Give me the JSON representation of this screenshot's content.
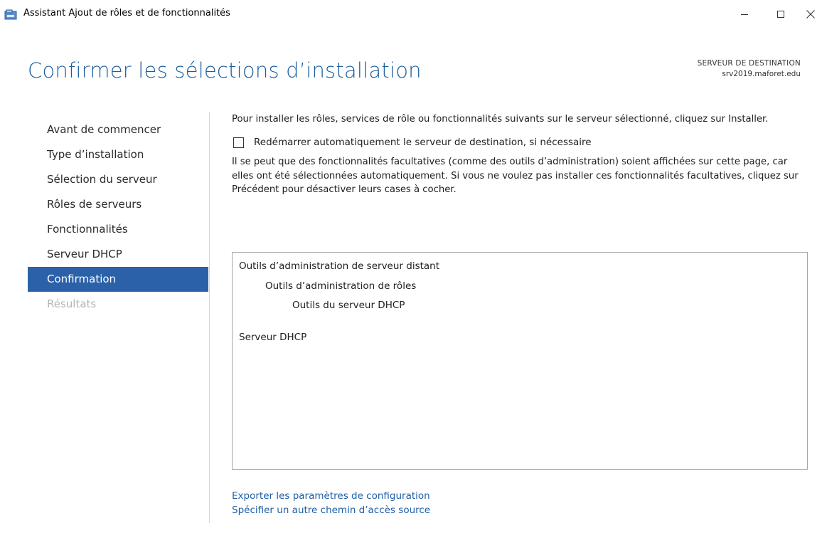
{
  "window": {
    "title": "Assistant Ajout de rôles et de fonctionnalités",
    "minimize_glyph": "—",
    "maximize_glyph": "☐",
    "close_glyph": "✕"
  },
  "header": {
    "title": "Confirmer les sélections d’installation",
    "destination_label": "SERVEUR DE DESTINATION",
    "destination_server": "srv2019.maforet.edu"
  },
  "nav": {
    "items": [
      {
        "label": "Avant de commencer",
        "state": "normal"
      },
      {
        "label": "Type d’installation",
        "state": "normal"
      },
      {
        "label": "Sélection du serveur",
        "state": "normal"
      },
      {
        "label": "Rôles de serveurs",
        "state": "normal"
      },
      {
        "label": "Fonctionnalités",
        "state": "normal"
      },
      {
        "label": "Serveur DHCP",
        "state": "normal"
      },
      {
        "label": "Confirmation",
        "state": "active"
      },
      {
        "label": "Résultats",
        "state": "disabled"
      }
    ]
  },
  "main": {
    "intro_text": "Pour installer les rôles, services de rôle ou fonctionnalités suivants sur le serveur sélectionné, cliquez sur Installer.",
    "restart_checkbox_label": "Redémarrer automatiquement le serveur de destination, si nécessaire",
    "restart_checked": false,
    "warning_text": "Il se peut que des fonctionnalités facultatives (comme des outils d’administration) soient affichées sur cette page, car elles ont été sélectionnées automatiquement. Si vous ne voulez pas installer ces fonctionnalités facultatives, cliquez sur Précédent pour désactiver leurs cases à cocher.",
    "selections": [
      {
        "label": "Outils d’administration de serveur distant"
      },
      {
        "label": "Outils d’administration de rôles"
      },
      {
        "label": "Outils du serveur DHCP"
      },
      {
        "label": "Serveur DHCP"
      }
    ],
    "links": {
      "export": "Exporter les paramètres de configuration",
      "alt_source": "Spécifier un autre chemin d’accès source"
    }
  },
  "colors": {
    "accent": "#2b61a8",
    "title_blue": "#1c5e9e",
    "link": "#1f5fa8",
    "disabled": "#b4b4b4"
  }
}
